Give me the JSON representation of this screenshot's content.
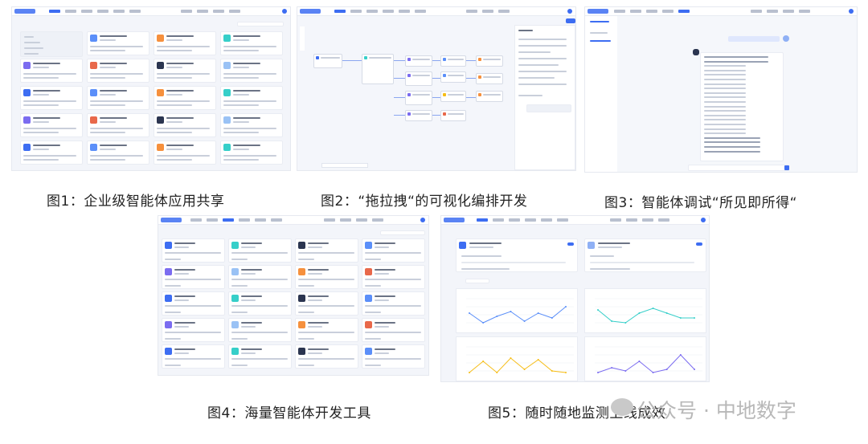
{
  "captions": {
    "fig1": "图1：企业级智能体应用共享",
    "fig2": "图2：“拖拉拽“的可视化编排开发",
    "fig3": "图3：智能体调试“所见即所得“",
    "fig4": "图4：海量智能体开发工具",
    "fig5": "图5：随时随地监测上线成效"
  },
  "watermark": {
    "text": "公众号 · 中地数字"
  },
  "colors": {
    "accent": "#3d6df2",
    "chart_line_blue": "#5b8ff9",
    "chart_line_green": "#36cfc9",
    "chart_line_orange": "#f6bd16",
    "chart_line_purple": "#7b6cf0"
  }
}
